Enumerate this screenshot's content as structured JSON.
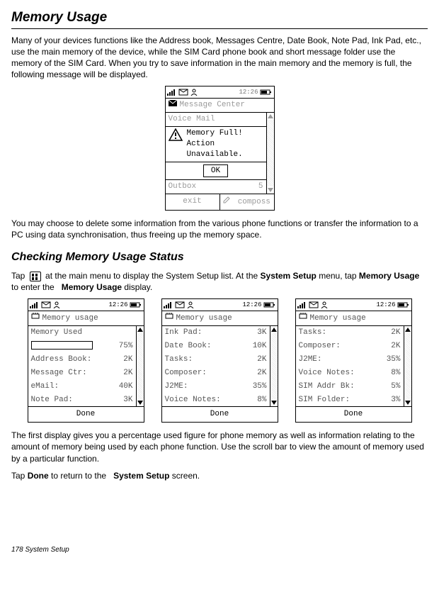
{
  "page": {
    "title": "Memory Usage",
    "intro": "Many of your devices functions like the Address book, Messages Centre, Date Book, Note Pad, Ink Pad, etc., use the main memory of the device, while the SIM Card phone book and short message folder use the memory of the SIM Card. When you try to save information in the main memory and the memory is full, the following message will be displayed.",
    "after_alert": "You may choose to delete some information from the various phone functions or transfer the information to a PC using data synchronisation, thus freeing up the memory space.",
    "section2_title": "Checking Memory Usage Status",
    "tap_line_a": "Tap ",
    "tap_line_b": " at the main menu to display the System       Setup list. At the ",
    "tap_line_c": " menu, tap ",
    "tap_line_d": " to enter the ",
    "tap_line_e": " display.",
    "bold1": "System Setup",
    "bold2": "Memory Usage",
    "bold3": "Memory Usage",
    "after_usage1": "The first display gives you a percentage used figure for phone memory as well as information relating to the amount of memory being used by each phone function. Use the scroll bar to view the amount of memory used by a particular function.",
    "after_usage2a": "Tap ",
    "after_usage2b": " to return to the ",
    "after_usage2c": " screen.",
    "bold_done": "Done",
    "bold_sys": "System Setup",
    "footer": "178   System Setup"
  },
  "status": {
    "time": "12:26"
  },
  "alert_phone": {
    "title": "Message Center",
    "line1": "Voice Mail",
    "msg1": "Memory Full!",
    "msg2": "Action",
    "msg3": "Unavailable.",
    "ok": "OK",
    "outbox_label": "Outbox",
    "outbox_count": "5",
    "btn_exit": "exit",
    "btn_compose": "composs"
  },
  "usage_title": "Memory usage",
  "done_label": "Done",
  "screen1": {
    "memory_used": "Memory Used",
    "percent": "75%",
    "rows": [
      {
        "label": "Address Book:",
        "val": "2K"
      },
      {
        "label": "Message Ctr:",
        "val": "2K"
      },
      {
        "label": "eMail:",
        "val": "40K"
      },
      {
        "label": "Note Pad:",
        "val": "3K"
      }
    ]
  },
  "screen2": {
    "rows": [
      {
        "label": "Ink Pad:",
        "val": "3K"
      },
      {
        "label": "Date Book:",
        "val": "10K"
      },
      {
        "label": "Tasks:",
        "val": "2K"
      },
      {
        "label": "Composer:",
        "val": "2K"
      },
      {
        "label": "J2ME:",
        "val": "35%"
      },
      {
        "label": "Voice Notes:",
        "val": "8%"
      }
    ]
  },
  "screen3": {
    "rows": [
      {
        "label": "Tasks:",
        "val": "2K"
      },
      {
        "label": "Composer:",
        "val": "2K"
      },
      {
        "label": "J2ME:",
        "val": "35%"
      },
      {
        "label": "Voice Notes:",
        "val": "8%"
      },
      {
        "label": "SIM Addr Bk:",
        "val": "5%"
      },
      {
        "label": "SIM Folder:",
        "val": "3%"
      }
    ]
  }
}
